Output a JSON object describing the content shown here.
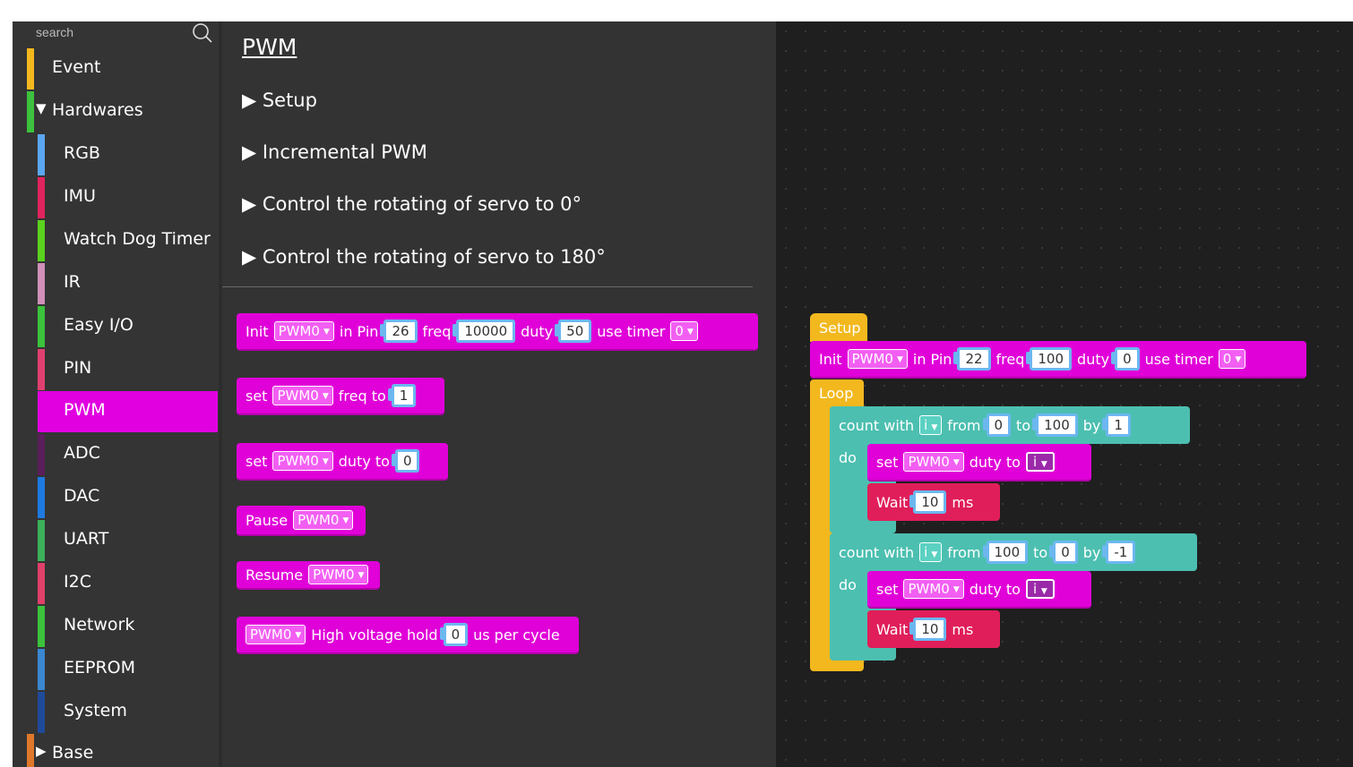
{
  "search": {
    "placeholder": "search"
  },
  "categories": [
    {
      "label": "Event",
      "color": "#f2b81e"
    },
    {
      "label": "Hardwares",
      "color": "#3cc23c"
    },
    {
      "label": "RGB",
      "color": "#5aa7f2"
    },
    {
      "label": "IMU",
      "color": "#e0245e"
    },
    {
      "label": "Watch Dog Timer",
      "color": "#5ad21e"
    },
    {
      "label": "IR",
      "color": "#d090b8"
    },
    {
      "label": "Easy I/O",
      "color": "#3cc23c"
    },
    {
      "label": "PIN",
      "color": "#e04070"
    },
    {
      "label": "PWM",
      "color": "#e000e0"
    },
    {
      "label": "ADC",
      "color": "#5a1e5a"
    },
    {
      "label": "DAC",
      "color": "#1e7ae0"
    },
    {
      "label": "UART",
      "color": "#3cb05a"
    },
    {
      "label": "I2C",
      "color": "#e0406a"
    },
    {
      "label": "Network",
      "color": "#3cc23c"
    },
    {
      "label": "EEPROM",
      "color": "#3a88d0"
    },
    {
      "label": "System",
      "color": "#1e4a9a"
    },
    {
      "label": "Base",
      "color": "#e0782a"
    }
  ],
  "flyout": {
    "title": "PWM",
    "examples": [
      "Setup",
      "Incremental PWM",
      "Control the rotating of servo to 0°",
      "Control the rotating of servo to 180°"
    ],
    "blocks": {
      "init": {
        "init": "Init",
        "pwm": "PWM0",
        "in_pin": "in Pin",
        "pin": "26",
        "freq": "freq",
        "freq_val": "10000",
        "duty": "duty",
        "duty_val": "50",
        "use_timer": "use timer",
        "timer": "0"
      },
      "set_freq": {
        "set": "set",
        "pwm": "PWM0",
        "freq_to": "freq to",
        "val": "1"
      },
      "set_duty": {
        "set": "set",
        "pwm": "PWM0",
        "duty_to": "duty to",
        "val": "0"
      },
      "pause": {
        "label": "Pause",
        "pwm": "PWM0"
      },
      "resume": {
        "label": "Resume",
        "pwm": "PWM0"
      },
      "hold": {
        "pwm": "PWM0",
        "high": "High voltage hold",
        "val": "0",
        "unit": "us per cycle"
      }
    }
  },
  "workspace": {
    "setup": {
      "label": "Setup"
    },
    "init": {
      "init": "Init",
      "pwm": "PWM0",
      "in_pin": "in Pin",
      "pin": "22",
      "freq": "freq",
      "freq_val": "100",
      "duty": "duty",
      "duty_val": "0",
      "use_timer": "use timer",
      "timer": "0"
    },
    "loop": {
      "label": "Loop"
    },
    "count1": {
      "count_with": "count with",
      "var": "i",
      "from": "from",
      "from_val": "0",
      "to": "to",
      "to_val": "100",
      "by": "by",
      "by_val": "1",
      "do": "do",
      "set": "set",
      "pwm": "PWM0",
      "duty_to": "duty to",
      "duty_var": "i",
      "wait": "Wait",
      "wait_val": "10",
      "ms": "ms"
    },
    "count2": {
      "count_with": "count with",
      "var": "i",
      "from": "from",
      "from_val": "100",
      "to": "to",
      "to_val": "0",
      "by": "by",
      "by_val": "-1",
      "do": "do",
      "set": "set",
      "pwm": "PWM0",
      "duty_to": "duty to",
      "duty_var": "i",
      "wait": "Wait",
      "wait_val": "10",
      "ms": "ms"
    }
  }
}
